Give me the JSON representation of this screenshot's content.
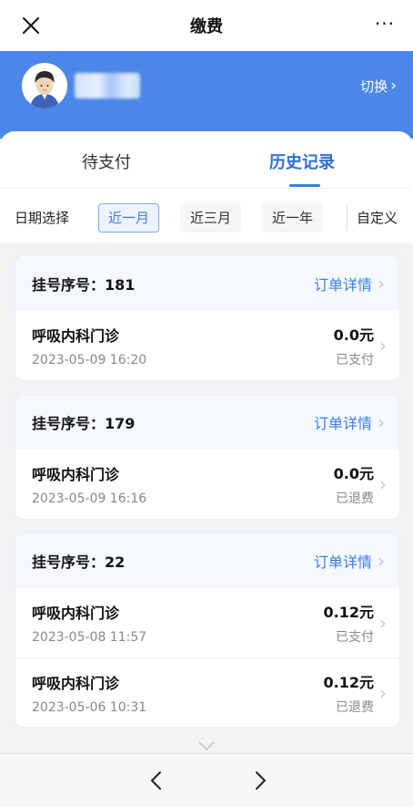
{
  "header": {
    "title": "缴费",
    "more": "···"
  },
  "user": {
    "switch_label": "切换"
  },
  "tabs": [
    {
      "label": "待支付"
    },
    {
      "label": "历史记录"
    }
  ],
  "date_filter": {
    "label": "日期选择",
    "options": [
      "近一月",
      "近三月",
      "近一年"
    ],
    "selected": "近一月",
    "custom": "自定义"
  },
  "orders": [
    {
      "serial": "挂号序号：181",
      "detail_link": "订单详情",
      "items": [
        {
          "dept": "呼吸内科门诊",
          "time": "2023-05-09 16:20",
          "amount": "0.0元",
          "status": "已支付"
        }
      ]
    },
    {
      "serial": "挂号序号：179",
      "detail_link": "订单详情",
      "items": [
        {
          "dept": "呼吸内科门诊",
          "time": "2023-05-09 16:16",
          "amount": "0.0元",
          "status": "已退费"
        }
      ]
    },
    {
      "serial": "挂号序号：22",
      "detail_link": "订单详情",
      "items": [
        {
          "dept": "呼吸内科门诊",
          "time": "2023-05-08 11:57",
          "amount": "0.12元",
          "status": "已支付"
        },
        {
          "dept": "呼吸内科门诊",
          "time": "2023-05-06 10:31",
          "amount": "0.12元",
          "status": "已退费"
        }
      ]
    }
  ],
  "colors": {
    "accent": "#3b7de6",
    "header_bg": "#4a87e8",
    "muted": "#888888"
  }
}
